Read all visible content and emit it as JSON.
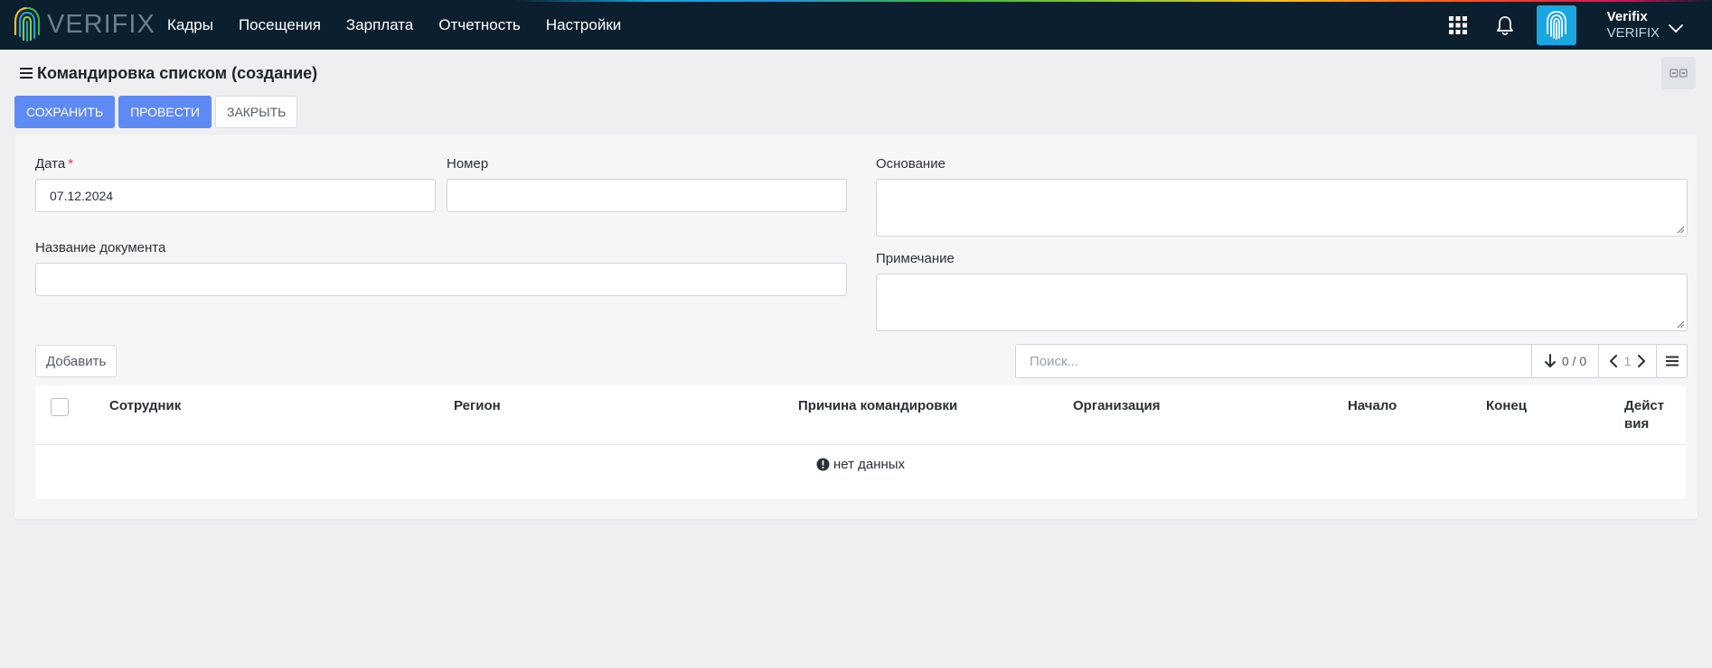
{
  "header": {
    "logo_text": "VERIFIX",
    "nav": [
      "Кадры",
      "Посещения",
      "Зарплата",
      "Отчетность",
      "Настройки"
    ],
    "user_name": "Verifix",
    "user_org": "VERIFIX"
  },
  "page": {
    "title": "Командировка списком (создание)"
  },
  "actions": {
    "save": "СОХРАНИТЬ",
    "post": "ПРОВЕСТИ",
    "close": "ЗАКРЫТЬ"
  },
  "form": {
    "date_label": "Дата",
    "date_required": "*",
    "date_value": "07.12.2024",
    "number_label": "Номер",
    "number_value": "",
    "basis_label": "Основание",
    "doc_name_label": "Название документа",
    "doc_name_value": "",
    "note_label": "Примечание"
  },
  "table": {
    "add_label": "Добавить",
    "search_placeholder": "Поиск...",
    "count": "0 / 0",
    "page": "1",
    "columns": [
      "Сотрудник",
      "Регион",
      "Причина командировки",
      "Организация",
      "Начало",
      "Конец",
      "Дейст\nвия"
    ],
    "empty": "нет данных"
  },
  "colors": {
    "navbar": "#0b1f2e",
    "primary": "#5e8af4",
    "avatar": "#1aa6e0"
  }
}
